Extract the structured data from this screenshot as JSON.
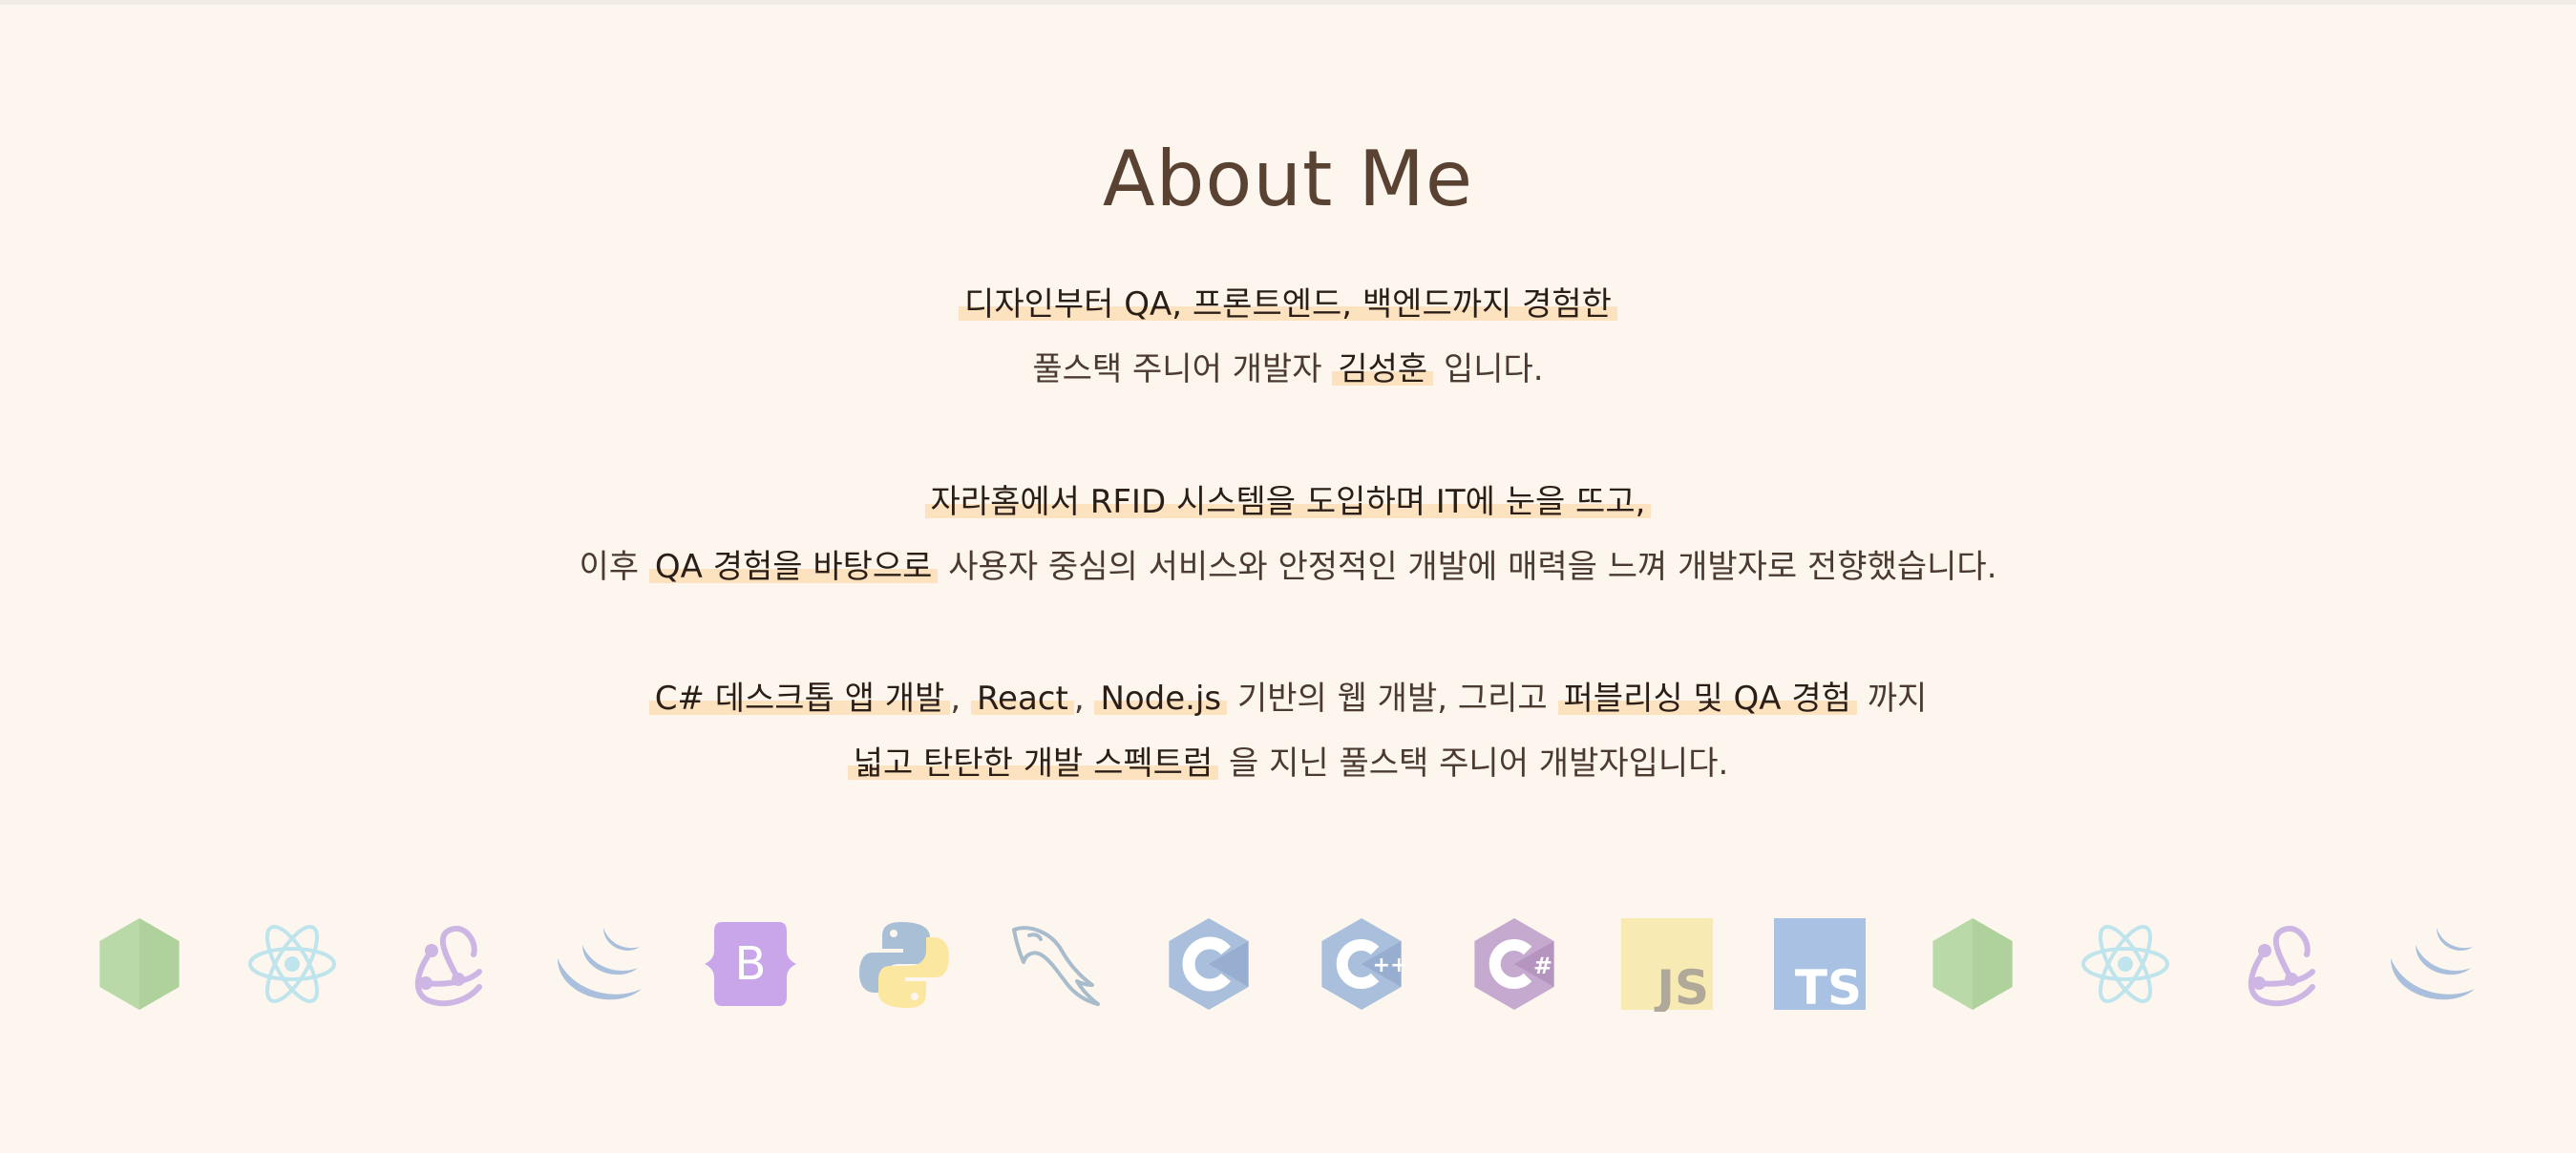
{
  "about": {
    "title": "About Me",
    "p1": {
      "hl1": "디자인부터 QA, 프론트엔드, 백엔드까지 경험한",
      "t1": "풀스택 주니어 개발자 ",
      "hl2": "김성훈",
      "t2": " 입니다."
    },
    "p2": {
      "hl1": "자라홈에서 RFID 시스템을 도입하며 IT에 눈을 뜨고,",
      "t1": "이후 ",
      "hl2": "QA 경험을 바탕으로",
      "t2": " 사용자 중심의 서비스와 안정적인 개발에 매력을 느껴 개발자로 전향했습니다."
    },
    "p3": {
      "hl1": "C# 데스크톱 앱 개발",
      "t1": ", ",
      "hl2": "React",
      "t2": ", ",
      "hl3": "Node.js",
      "t3": " 기반의 웹 개발, 그리고 ",
      "hl4": "퍼블리싱 및 QA 경험",
      "t4": " 까지",
      "hl5": "넓고 탄탄한 개발 스펙트럼",
      "t5": " 을 지닌 풀스택 주니어 개발자입니다."
    }
  },
  "tech_icons": [
    {
      "icon": "nodejs-icon"
    },
    {
      "icon": "react-icon"
    },
    {
      "icon": "redux-icon"
    },
    {
      "icon": "jquery-icon"
    },
    {
      "icon": "bootstrap-icon",
      "text": "B"
    },
    {
      "icon": "python-icon"
    },
    {
      "icon": "mysql-icon"
    },
    {
      "icon": "c-icon"
    },
    {
      "icon": "cpp-icon",
      "text": "++"
    },
    {
      "icon": "csharp-icon",
      "text": "#"
    },
    {
      "icon": "javascript-icon",
      "text": "JS"
    },
    {
      "icon": "typescript-icon",
      "text": "TS"
    },
    {
      "icon": "nodejs-icon"
    },
    {
      "icon": "react-icon"
    },
    {
      "icon": "redux-icon"
    },
    {
      "icon": "jquery-icon"
    }
  ],
  "colors": {
    "background": "#fdf6ef",
    "highlight": "#fde2c0",
    "title": "#5a4233",
    "nodejs": "#b9d9a8",
    "react": "#bfe4ec",
    "redux": "#cdb6e4",
    "jquery": "#a9bfdc",
    "bootstrap": "#c9a6ea",
    "python_blue": "#a9bfd6",
    "python_yellow": "#fbe7a0",
    "mysql": "#a9bccb",
    "c": "#a9bfdc",
    "cpp": "#a9bfdc",
    "csharp": "#c6a9cf",
    "javascript": "#f7eab2",
    "typescript": "#a9c2e4"
  }
}
